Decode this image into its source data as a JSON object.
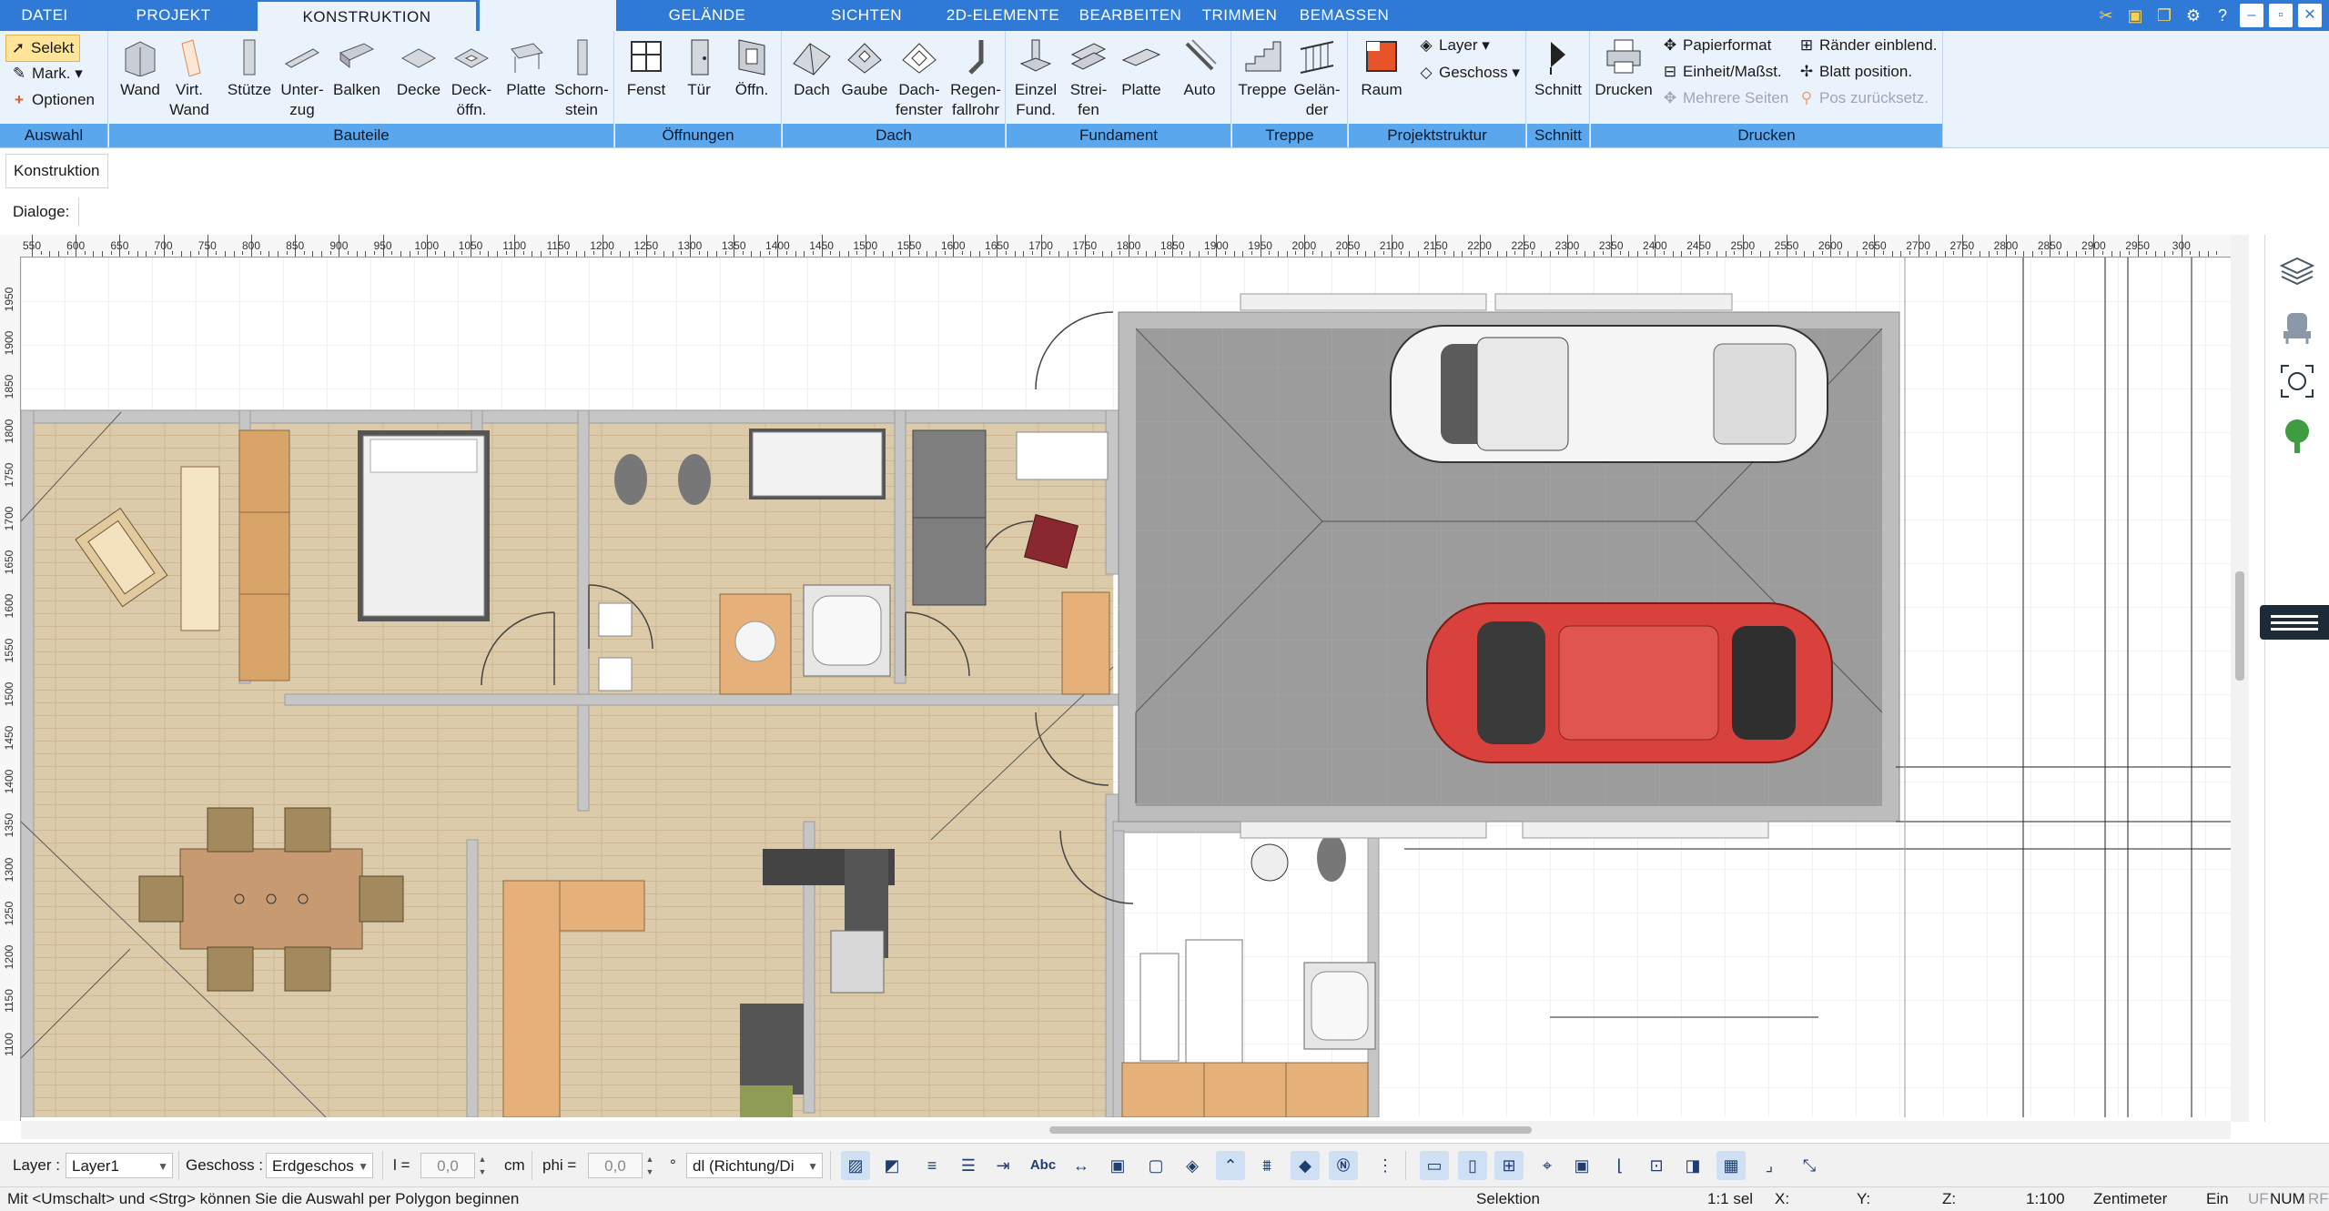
{
  "menu": {
    "tabs": [
      {
        "label": "DATEI",
        "active": false
      },
      {
        "label": "PROJEKT",
        "active": false
      },
      {
        "label": "KONSTRUKTION",
        "active": true
      },
      {
        "label": "",
        "active": false
      },
      {
        "label": "GELÄNDE",
        "active": false
      },
      {
        "label": "SICHTEN",
        "active": false
      },
      {
        "label": "2D-ELEMENTE",
        "active": false
      },
      {
        "label": "BEARBEITEN",
        "active": false
      },
      {
        "label": "TRIMMEN",
        "active": false
      },
      {
        "label": "BEMASSEN",
        "active": false
      }
    ],
    "window_controls": [
      "tools-icon",
      "folder-icon",
      "copy-icon",
      "settings-icon",
      "help-icon",
      "minimize-icon",
      "restore-icon",
      "close-icon"
    ]
  },
  "ribbon": {
    "auswahl": {
      "label": "Auswahl",
      "selekt": "Selekt",
      "mark": "Mark.",
      "optionen": "Optionen"
    },
    "bauteile": {
      "label": "Bauteile",
      "buttons": [
        "Wand",
        "Virt.\nWand",
        "Stütze",
        "Unter-\nzug",
        "Balken",
        "Decke",
        "Deck-\nöffn.",
        "Platte",
        "Schorn-\nstein"
      ]
    },
    "oeffnungen": {
      "label": "Öffnungen",
      "buttons": [
        "Fenst",
        "Tür",
        "Öffn."
      ]
    },
    "dach": {
      "label": "Dach",
      "buttons": [
        "Dach",
        "Gaube",
        "Dach-\nfenster",
        "Regen-\nfallrohr"
      ]
    },
    "fundament": {
      "label": "Fundament",
      "buttons": [
        "Einzel\nFund.",
        "Strei-\nfen",
        "Platte",
        "Auto"
      ]
    },
    "treppe": {
      "label": "Treppe",
      "buttons": [
        "Treppe",
        "Gelän-\nder"
      ]
    },
    "projektstruktur": {
      "label": "Projektstruktur",
      "raum": "Raum",
      "layer": "Layer",
      "geschoss": "Geschoss"
    },
    "schnitt": {
      "label": "Schnitt",
      "button": "Schnitt"
    },
    "drucken": {
      "label": "Drucken",
      "button": "Drucken",
      "papierformat": "Papierformat",
      "einheit": "Einheit/Maßst.",
      "mehrere_seiten": "Mehrere Seiten",
      "raender": "Ränder einblend.",
      "blatt": "Blatt position.",
      "pos_zurueck": "Pos zurücksetz."
    }
  },
  "subtab": {
    "label": "Konstruktion"
  },
  "dialoge": {
    "label": "Dialoge:"
  },
  "ruler": {
    "h_labels": [
      "550",
      "600",
      "650",
      "700",
      "750",
      "800",
      "850",
      "900",
      "950",
      "1000",
      "1050",
      "1100",
      "1150",
      "1200",
      "1250",
      "1300",
      "1350",
      "1400",
      "1450",
      "1500",
      "1550",
      "1600",
      "1650",
      "1700",
      "1750",
      "1800",
      "1850",
      "1900",
      "1950",
      "2000",
      "2050",
      "2100",
      "2150",
      "2200",
      "2250",
      "2300",
      "2350",
      "2400",
      "2450",
      "2500",
      "2550",
      "2600",
      "2650",
      "2700",
      "2750",
      "2800",
      "2850",
      "2900",
      "2950",
      "300"
    ],
    "v_labels": [
      "1950",
      "1900",
      "1850",
      "1800",
      "1750",
      "1700",
      "1650",
      "1600",
      "1550",
      "1500",
      "1450",
      "1400",
      "1350",
      "1300",
      "1250",
      "1200",
      "1150",
      "1100"
    ]
  },
  "bottom_toolbar": {
    "layer_label": "Layer :",
    "layer_value": "Layer1",
    "geschoss_label": "Geschoss :",
    "geschoss_value": "Erdgeschos",
    "l_label": "l =",
    "l_value": "0,0",
    "l_unit": "cm",
    "phi_label": "phi =",
    "phi_value": "0,0",
    "phi_unit": "°",
    "mode_value": "dl (Richtung/Di",
    "abc": "Abc"
  },
  "status": {
    "hint": "Mit <Umschalt> und <Strg> können Sie die Auswahl per Polygon beginnen",
    "mode": "Selektion",
    "sel": "1:1 sel",
    "x": "X:",
    "y": "Y:",
    "z": "Z:",
    "scale": "1:100",
    "unit": "Zentimeter",
    "ein": "Ein",
    "uf": "UF",
    "num": "NUM",
    "rf": "RF"
  },
  "colors": {
    "menubar": "#2f7ad6",
    "ribbon": "#eaf3fc",
    "group_label": "#5aa7ee",
    "floor_wood": "#d8c7a6",
    "garage_floor": "#9a9a9a",
    "wall": "#c8c8c8",
    "car_red": "#d9423c",
    "car_white": "#f4f4f4"
  }
}
